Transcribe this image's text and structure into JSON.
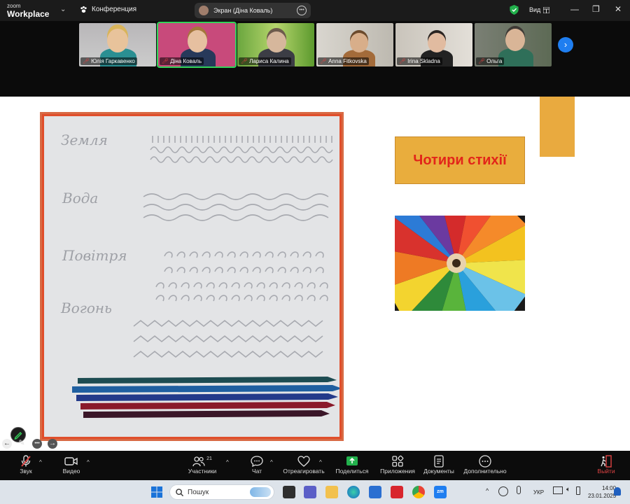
{
  "app": {
    "logo_top": "zoom",
    "logo_bottom": "Workplace",
    "meeting_label": "Конференция"
  },
  "share": {
    "label": "Экран (Діна Коваль)"
  },
  "view": {
    "label": "Вид"
  },
  "participants": [
    {
      "name": "Юлія Гаркавенко"
    },
    {
      "name": "Діна Коваль"
    },
    {
      "name": "Лариса Калина"
    },
    {
      "name": "Anna Fitkovska"
    },
    {
      "name": "Irina Skladna"
    },
    {
      "name": "Ольга"
    }
  ],
  "slide": {
    "title": "Чотири стихії",
    "handwriting": [
      "Земля",
      "Вода",
      "Повітря",
      "Вогонь"
    ]
  },
  "toolbar": {
    "audio": "Звук",
    "video": "Видео",
    "participants": "Участники",
    "participants_count": "21",
    "chat": "Чат",
    "react": "Отреагировать",
    "share": "Поделиться",
    "apps": "Приложения",
    "docs": "Документы",
    "more": "Дополнительно",
    "leave": "Выйти"
  },
  "taskbar": {
    "search_placeholder": "Пошук",
    "lang": "УКР",
    "time": "14:00",
    "date": "23.01.2025"
  },
  "colors": {
    "accent": "#1f7ef0",
    "share_green": "#22b14c",
    "active_speaker": "#32d35a",
    "slide_title": "#e2251a",
    "slide_box": "#e9ad3d"
  }
}
